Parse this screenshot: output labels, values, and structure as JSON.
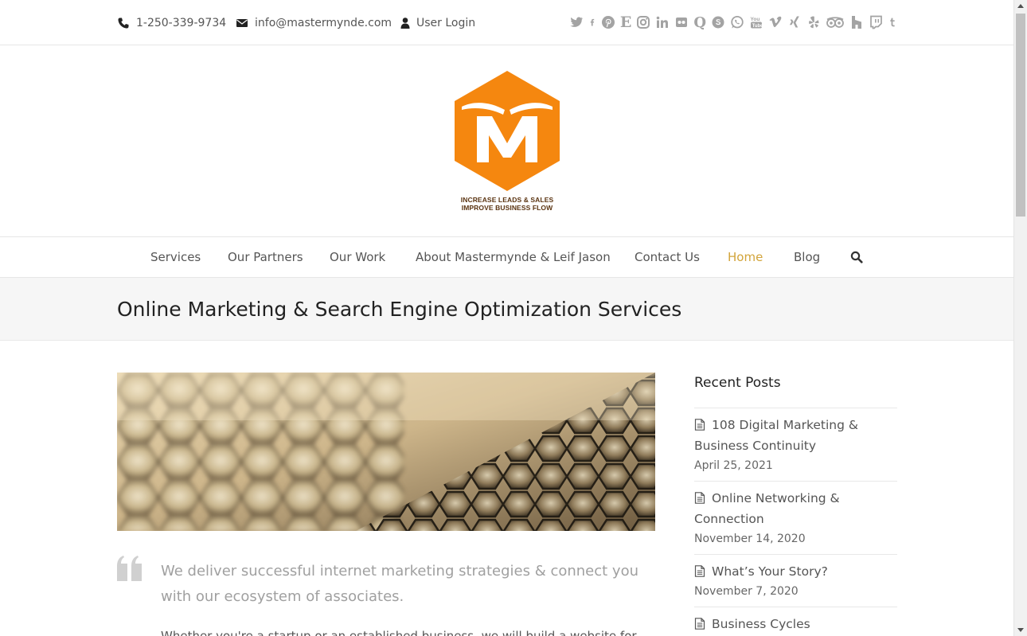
{
  "topbar": {
    "phone": "1-250-339-9734",
    "email": "info@mastermynde.com",
    "login": "User Login",
    "social_icons": [
      "twitter-icon",
      "facebook-icon",
      "pinterest-icon",
      "etsy-icon",
      "instagram-icon",
      "linkedin-icon",
      "flickr-icon",
      "quora-icon",
      "skype-icon",
      "whatsapp-icon",
      "youtube-icon",
      "vimeo-icon",
      "xing-icon",
      "yelp-icon",
      "tripadvisor-icon",
      "houzz-icon",
      "twitch-icon",
      "tumblr-icon"
    ]
  },
  "logo": {
    "letter": "M",
    "tagline_line1": "INCREASE LEADS & SALES",
    "tagline_line2": "IMPROVE BUSINESS FLOW",
    "color": "#f5870f"
  },
  "nav": {
    "items": [
      {
        "label": "Services"
      },
      {
        "label": "Our Partners"
      },
      {
        "label": "Our Work"
      },
      {
        "label": "About Mastermynde & Leif Jason"
      },
      {
        "label": "Contact Us"
      },
      {
        "label": "Home",
        "active": true
      },
      {
        "label": "Blog"
      }
    ],
    "active_color": "#d2a43a"
  },
  "page": {
    "title": "Online Marketing & Search Engine Optimization Services",
    "quote": "We deliver successful internet marketing strategies & connect you with our ecosystem of associates.",
    "body_partial": "Whether you're a startup or an established business, we will build a website for you that brings"
  },
  "sidebar": {
    "title": "Recent Posts",
    "posts": [
      {
        "title": "108 Digital Marketing & Business Continuity",
        "date": "April 25, 2021"
      },
      {
        "title": "Online Networking & Connection",
        "date": "November 14, 2020"
      },
      {
        "title": "What’s Your Story?",
        "date": "November 7, 2020"
      },
      {
        "title": "Business Cycles",
        "date": ""
      }
    ]
  }
}
